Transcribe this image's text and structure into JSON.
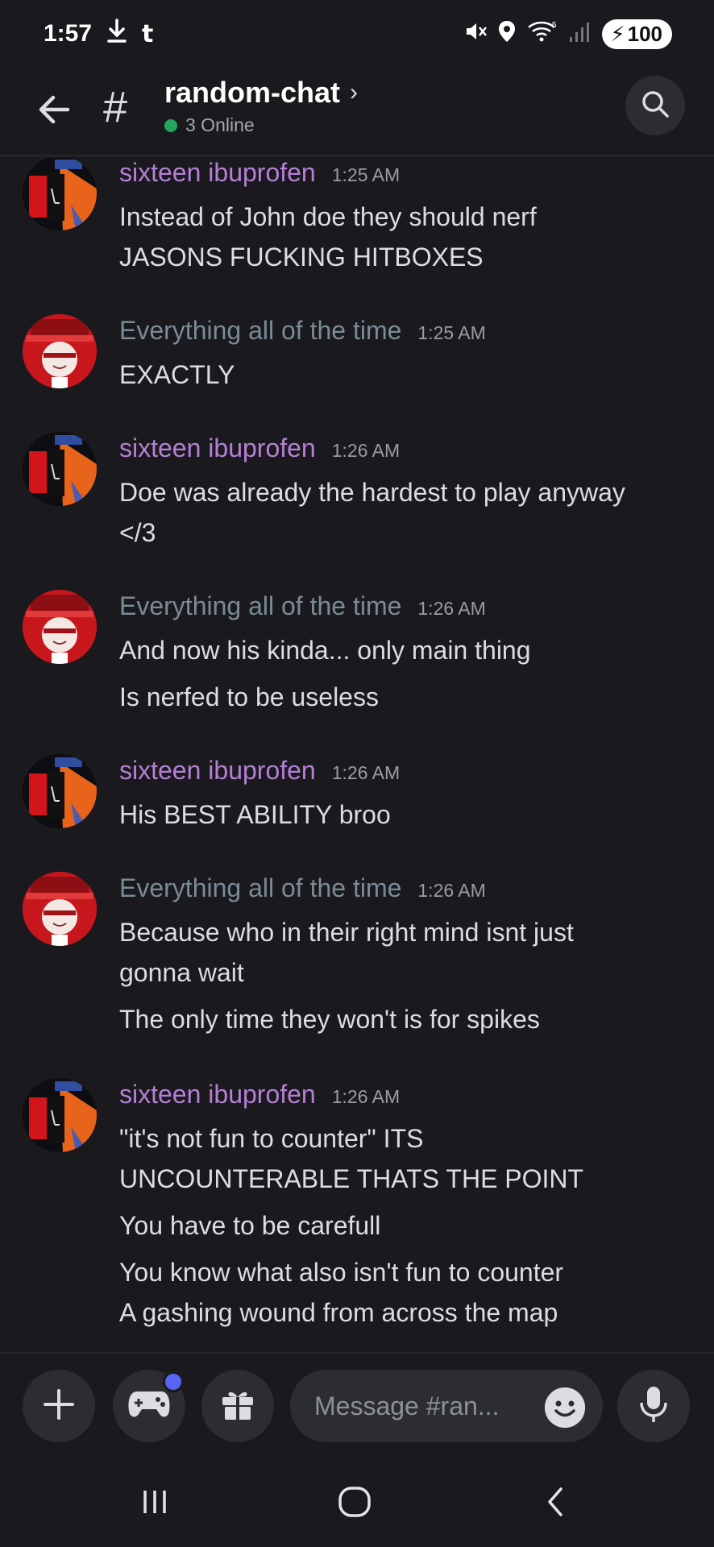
{
  "status_bar": {
    "time": "1:57",
    "battery": "100"
  },
  "header": {
    "channel": "random-chat",
    "online": "3 Online"
  },
  "messages": [
    {
      "author": "sixteen ibuprofen",
      "author_color": "#b57fd6",
      "avatar": "avatar-dark",
      "time": "1:25 AM",
      "lines": [
        "Instead of John doe they should nerf",
        "JASONS FUCKING HITBOXES"
      ]
    },
    {
      "author": "Everything all of the time",
      "author_color": "#7a8b97",
      "avatar": "avatar-red",
      "time": "1:25 AM",
      "lines": [
        "EXACTLY"
      ]
    },
    {
      "author": "sixteen ibuprofen",
      "author_color": "#b57fd6",
      "avatar": "avatar-dark",
      "time": "1:26 AM",
      "lines": [
        "Doe was already the hardest to play anyway",
        "</3"
      ]
    },
    {
      "author": "Everything all of the time",
      "author_color": "#7a8b97",
      "avatar": "avatar-red",
      "time": "1:26 AM",
      "lines": [
        "And now his kinda... only main thing",
        "Is nerfed to be useless"
      ]
    },
    {
      "author": "sixteen ibuprofen",
      "author_color": "#b57fd6",
      "avatar": "avatar-dark",
      "time": "1:26 AM",
      "lines": [
        "His BEST ABILITY broo"
      ]
    },
    {
      "author": "Everything all of the time",
      "author_color": "#7a8b97",
      "avatar": "avatar-red",
      "time": "1:26 AM",
      "lines": [
        "Because who in their right mind isnt just",
        "gonna wait",
        "The only time they won't is for spikes"
      ]
    },
    {
      "author": "sixteen ibuprofen",
      "author_color": "#b57fd6",
      "avatar": "avatar-dark",
      "time": "1:26 AM",
      "lines": [
        "\"it's not fun to counter\" ITS",
        "UNCOUNTERABLE THATS THE POINT",
        "You have to be carefull",
        "You know what also isn't fun to counter",
        "A gashing wound from across the map"
      ]
    }
  ],
  "composer": {
    "placeholder": "Message #ran..."
  },
  "colors": {
    "background": "#1a1a1e",
    "online_dot": "#23a55a",
    "notification_dot": "#5865f2"
  }
}
